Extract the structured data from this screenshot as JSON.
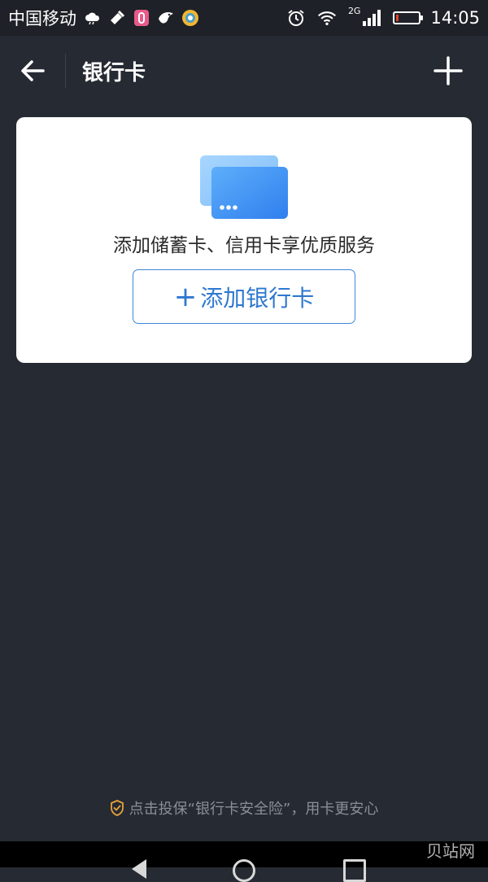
{
  "status_bar": {
    "carrier": "中国移动",
    "network": "2G",
    "time": "14:05",
    "battery_level_percent": 10,
    "icons": [
      "cloud-icon",
      "tool-icon",
      "notification-app-icon",
      "bird-app-icon",
      "app-badge-icon",
      "alarm-icon",
      "wifi-icon",
      "signal-icon",
      "battery-icon"
    ]
  },
  "header": {
    "title": "银行卡",
    "back_icon": "arrow-left-icon",
    "add_icon": "plus-icon"
  },
  "card": {
    "description": "添加储蓄卡、信用卡享优质服务",
    "button_plus": "+",
    "button_label": "添加银行卡",
    "illustration_icon": "bank-cards-icon"
  },
  "footer": {
    "insurance_text": "点击投保“银行卡安全险”，用卡更安心",
    "insurance_icon": "shield-check-icon"
  },
  "watermark": "贝站网",
  "colors": {
    "background": "#262a32",
    "card": "#ffffff",
    "accent": "#2f78d0",
    "shield": "#e8a33a"
  }
}
